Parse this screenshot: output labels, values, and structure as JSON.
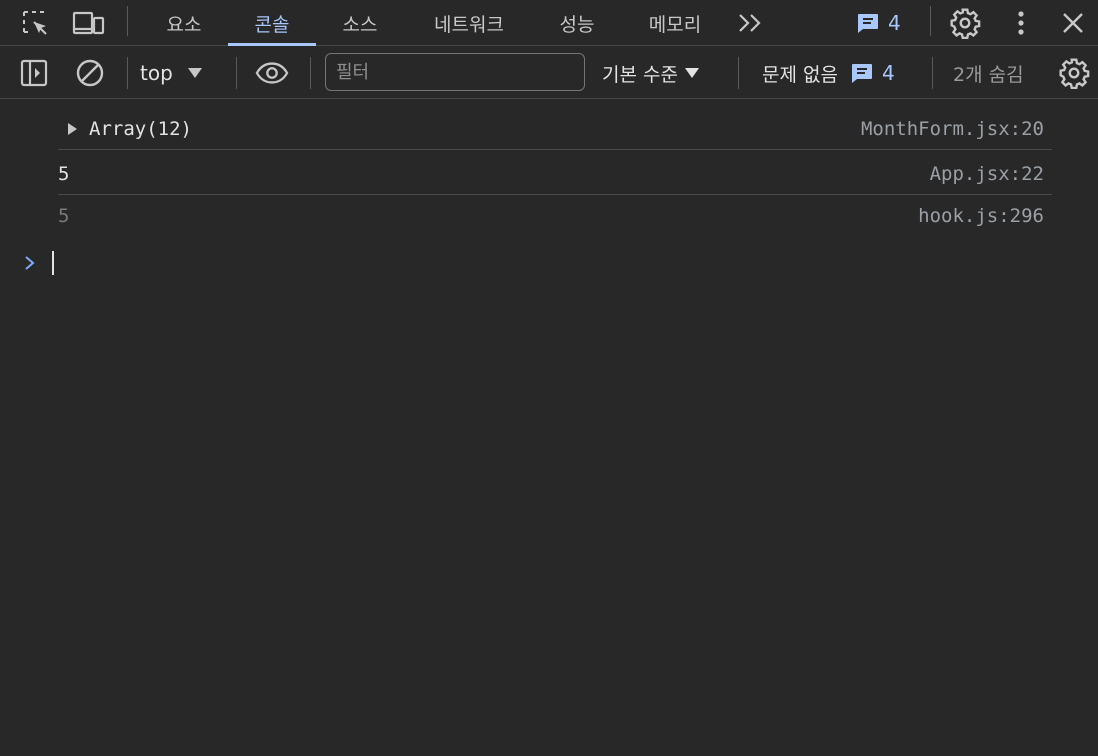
{
  "tabs": [
    {
      "label": "요소"
    },
    {
      "label": "콘솔"
    },
    {
      "label": "소스"
    },
    {
      "label": "네트워크"
    },
    {
      "label": "성능"
    },
    {
      "label": "메모리"
    }
  ],
  "active_tab": "콘솔",
  "message_badge_count": "4",
  "toolbar": {
    "context": "top",
    "filter_placeholder": "필터",
    "level": "기본 수준",
    "issues_label": "문제 없음",
    "issues_count": "4",
    "hidden_count": "2개 숨김"
  },
  "messages": [
    {
      "text": "Array(12)",
      "source": "MonthForm.jsx:20",
      "expandable": true
    },
    {
      "text": "5",
      "source": "App.jsx:22"
    },
    {
      "text": "5",
      "source": "hook.js:296",
      "dim": true
    }
  ],
  "colors": {
    "accent": "#a8c7fa",
    "background": "#282828",
    "divider": "#474747"
  }
}
